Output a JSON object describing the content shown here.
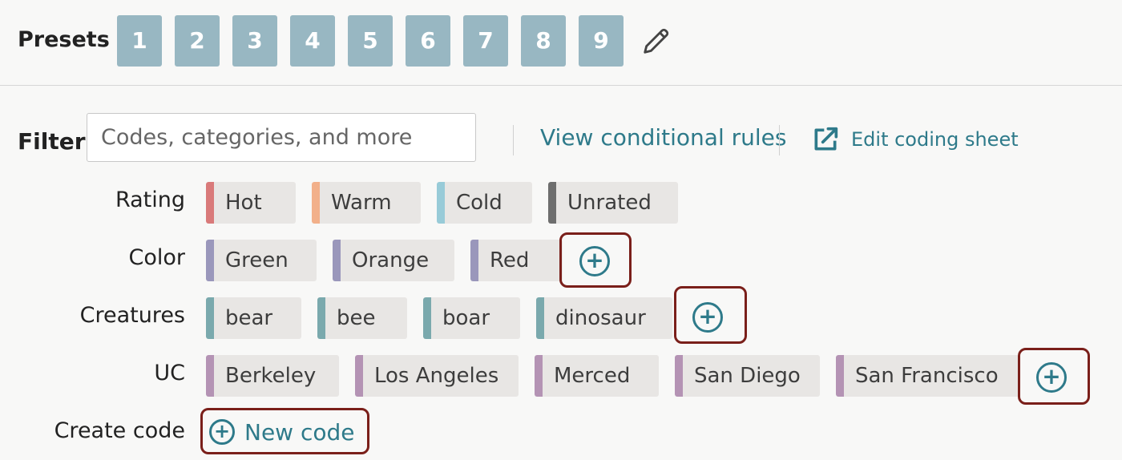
{
  "presets": {
    "label": "Presets",
    "buttons": [
      "1",
      "2",
      "3",
      "4",
      "5",
      "6",
      "7",
      "8",
      "9"
    ],
    "edit_icon": "pencil-icon",
    "button_color": "#98b7c2"
  },
  "filter": {
    "label": "Filter",
    "placeholder": "Codes, categories, and more",
    "value": ""
  },
  "links": {
    "conditional_rules": "View conditional rules",
    "edit_sheet": "Edit coding sheet",
    "edit_sheet_icon": "external-link-icon",
    "color": "#2e7a8a"
  },
  "categories": {
    "rating": {
      "label": "Rating",
      "codes": [
        {
          "label": "Hot",
          "color": "#d97a7a"
        },
        {
          "label": "Warm",
          "color": "#f2b08a"
        },
        {
          "label": "Cold",
          "color": "#98cbd8"
        },
        {
          "label": "Unrated",
          "color": "#6e6e6e"
        }
      ]
    },
    "color": {
      "label": "Color",
      "codes": [
        {
          "label": "Green",
          "color": "#9a97bb"
        },
        {
          "label": "Orange",
          "color": "#9a97bb"
        },
        {
          "label": "Red",
          "color": "#9a97bb"
        }
      ],
      "add_icon": "plus-circle-icon"
    },
    "creatures": {
      "label": "Creatures",
      "codes": [
        {
          "label": "bear",
          "color": "#7aa9ad"
        },
        {
          "label": "bee",
          "color": "#7aa9ad"
        },
        {
          "label": "boar",
          "color": "#7aa9ad"
        },
        {
          "label": "dinosaur",
          "color": "#7aa9ad"
        }
      ],
      "add_icon": "plus-circle-icon"
    },
    "uc": {
      "label": "UC",
      "codes": [
        {
          "label": "Berkeley",
          "color": "#b493b4"
        },
        {
          "label": "Los Angeles",
          "color": "#b493b4"
        },
        {
          "label": "Merced",
          "color": "#b493b4"
        },
        {
          "label": "San Diego",
          "color": "#b493b4"
        },
        {
          "label": "San Francisco",
          "color": "#b493b4"
        }
      ],
      "add_icon": "plus-circle-icon"
    }
  },
  "create_code": {
    "label": "Create code",
    "button": "New code",
    "icon": "plus-circle-icon"
  },
  "highlight_color": "#7a1f1a"
}
